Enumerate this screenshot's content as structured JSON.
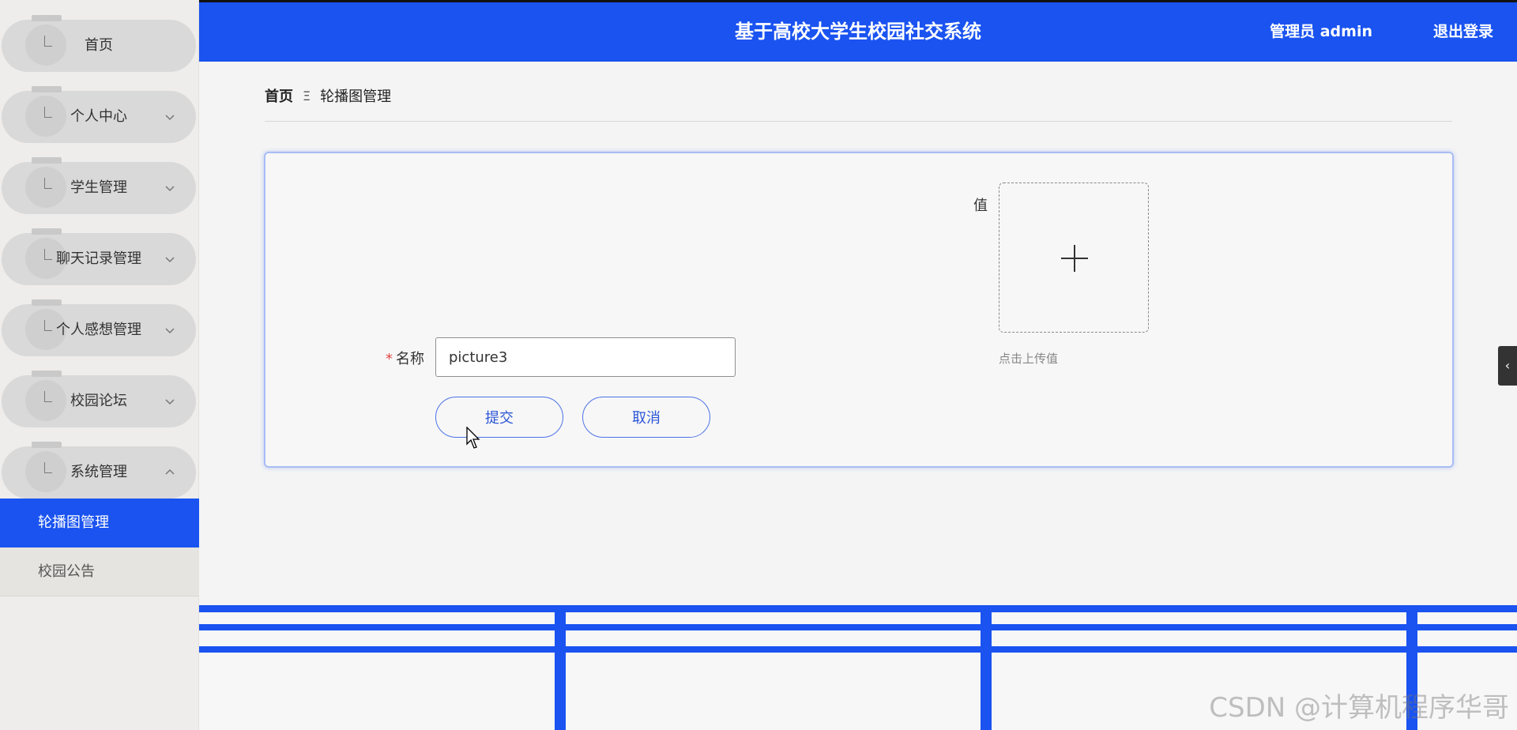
{
  "header": {
    "title": "基于高校大学生校园社交系统",
    "user": "管理员 admin",
    "logout": "退出登录"
  },
  "sidebar": {
    "items": [
      {
        "label": "首页",
        "expandable": false
      },
      {
        "label": "个人中心",
        "expandable": true,
        "expanded": false
      },
      {
        "label": "学生管理",
        "expandable": true,
        "expanded": false
      },
      {
        "label": "聊天记录管理",
        "expandable": true,
        "expanded": false
      },
      {
        "label": "个人感想管理",
        "expandable": true,
        "expanded": false
      },
      {
        "label": "校园论坛",
        "expandable": true,
        "expanded": false
      },
      {
        "label": "系统管理",
        "expandable": true,
        "expanded": true
      }
    ],
    "subitems": [
      {
        "label": "轮播图管理",
        "active": true
      },
      {
        "label": "校园公告",
        "active": false
      }
    ]
  },
  "breadcrumb": {
    "home": "首页",
    "separator": "Ξ",
    "current": "轮播图管理"
  },
  "form": {
    "name_label": "名称",
    "name_value": "picture3",
    "value_label": "值",
    "upload_hint": "点击上传值",
    "submit_label": "提交",
    "cancel_label": "取消"
  },
  "side_tab": "‹",
  "watermark": "CSDN @计算机程序华哥",
  "colors": {
    "primary": "#1a53f0",
    "sidebar_bg": "#efedeb",
    "menu_pill": "#d9d9d9",
    "required": "#e04444"
  }
}
